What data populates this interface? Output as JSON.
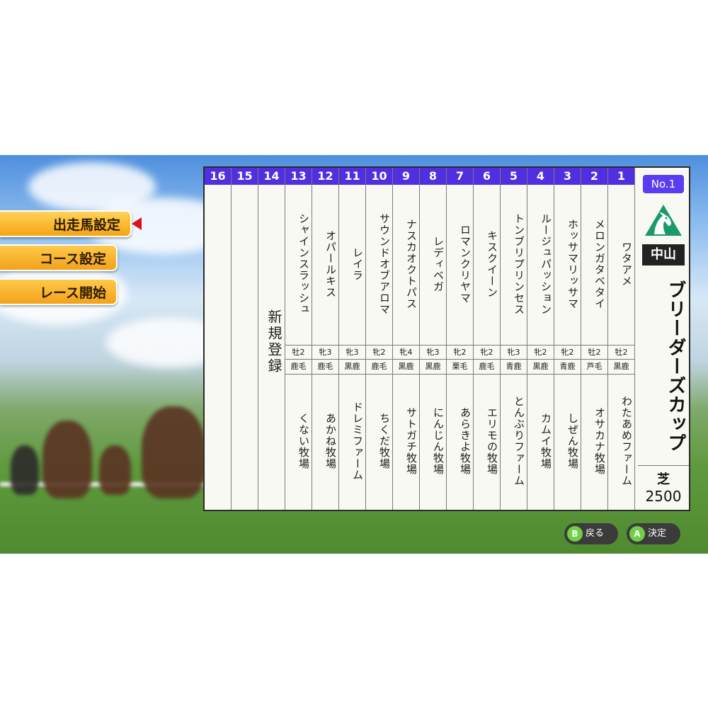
{
  "menu": {
    "items": [
      {
        "label": "出走馬設定",
        "active": true
      },
      {
        "label": "コース設定",
        "active": false
      },
      {
        "label": "レース開始",
        "active": false
      }
    ]
  },
  "race_card": {
    "columns": [
      {
        "number": "16",
        "name": "",
        "sex_age": "",
        "coat": "",
        "farm": ""
      },
      {
        "number": "15",
        "name": "",
        "sex_age": "",
        "coat": "",
        "farm": ""
      },
      {
        "number": "14",
        "name": "",
        "sex_age": "",
        "coat": "",
        "farm": "",
        "new_entry": "新規登録"
      },
      {
        "number": "13",
        "name": "シャインスラッシュ",
        "sex_age": "牡2",
        "coat": "鹿毛",
        "farm": "くない牧場"
      },
      {
        "number": "12",
        "name": "オパールキス",
        "sex_age": "牝3",
        "coat": "鹿毛",
        "farm": "あかね牧場"
      },
      {
        "number": "11",
        "name": "レイラ",
        "sex_age": "牝3",
        "coat": "黒鹿",
        "farm": "ドレミファーム"
      },
      {
        "number": "10",
        "name": "サウンドオブアロマ",
        "sex_age": "牝2",
        "coat": "鹿毛",
        "farm": "ちくだ牧場"
      },
      {
        "number": "9",
        "name": "ナスカオクトパス",
        "sex_age": "牝4",
        "coat": "黒鹿",
        "farm": "サトガチ牧場"
      },
      {
        "number": "8",
        "name": "レディベガ",
        "sex_age": "牝3",
        "coat": "黒鹿",
        "farm": "にんじん牧場"
      },
      {
        "number": "7",
        "name": "ロマンクリヤマ",
        "sex_age": "牝2",
        "coat": "栗毛",
        "farm": "あらきよ牧場"
      },
      {
        "number": "6",
        "name": "キスクイーン",
        "sex_age": "牝2",
        "coat": "鹿毛",
        "farm": "エリモの牧場"
      },
      {
        "number": "5",
        "name": "トンブリプリンセス",
        "sex_age": "牝3",
        "coat": "青鹿",
        "farm": "とんぶりファーム"
      },
      {
        "number": "4",
        "name": "ルージュパッション",
        "sex_age": "牝2",
        "coat": "黒鹿",
        "farm": "カムイ牧場"
      },
      {
        "number": "3",
        "name": "ホッサマリッサマ",
        "sex_age": "牝2",
        "coat": "青鹿",
        "farm": "しぜん牧場"
      },
      {
        "number": "2",
        "name": "メロンガタベタイ",
        "sex_age": "牡2",
        "coat": "芦毛",
        "farm": "オサカナ牧場"
      },
      {
        "number": "1",
        "name": "ワタアメ",
        "sex_age": "牡2",
        "coat": "黒鹿",
        "farm": "わたあめファーム"
      }
    ],
    "info": {
      "badge": "No.1",
      "venue": "中山",
      "race_name": "ブリーダーズカップ",
      "surface": "芝",
      "distance": "2500"
    }
  },
  "controls": {
    "back": {
      "key": "B",
      "label": "戻る"
    },
    "confirm": {
      "key": "A",
      "label": "決定"
    }
  },
  "colors": {
    "number_header": "#4f2fe0",
    "menu_button": "#f6a512",
    "menu_pointer": "#e0101e",
    "badge": "#5a3df0",
    "emblem": "#1a9a6a"
  }
}
